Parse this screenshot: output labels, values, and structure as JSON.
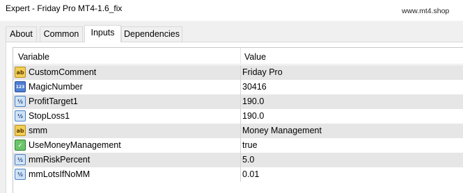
{
  "window": {
    "title": "Expert - Friday Pro MT4-1.6_fix",
    "watermark": "www.mt4.shop"
  },
  "tabs": [
    {
      "label": "About",
      "active": false
    },
    {
      "label": "Common",
      "active": false
    },
    {
      "label": "Inputs",
      "active": true
    },
    {
      "label": "Dependencies",
      "active": false
    }
  ],
  "table": {
    "columns": {
      "variable": "Variable",
      "value": "Value"
    },
    "rows": [
      {
        "icon": "string-ab-icon",
        "glyph": "ab",
        "variable": "CustomComment",
        "value": "Friday Pro"
      },
      {
        "icon": "integer-123-icon",
        "glyph": "123",
        "variable": "MagicNumber",
        "value": "30416"
      },
      {
        "icon": "double-half-icon",
        "glyph": "½",
        "variable": "ProfitTarget1",
        "value": "190.0"
      },
      {
        "icon": "double-half-icon",
        "glyph": "½",
        "variable": "StopLoss1",
        "value": "190.0"
      },
      {
        "icon": "string-ab-icon",
        "glyph": "ab",
        "variable": "smm",
        "value": "Money Management"
      },
      {
        "icon": "boolean-check-icon",
        "glyph": "✓",
        "variable": "UseMoneyManagement",
        "value": "true"
      },
      {
        "icon": "double-half-icon",
        "glyph": "½",
        "variable": "mmRiskPercent",
        "value": "5.0"
      },
      {
        "icon": "double-half-icon",
        "glyph": "½",
        "variable": "mmLotsIfNoMM",
        "value": "0.01"
      }
    ]
  }
}
